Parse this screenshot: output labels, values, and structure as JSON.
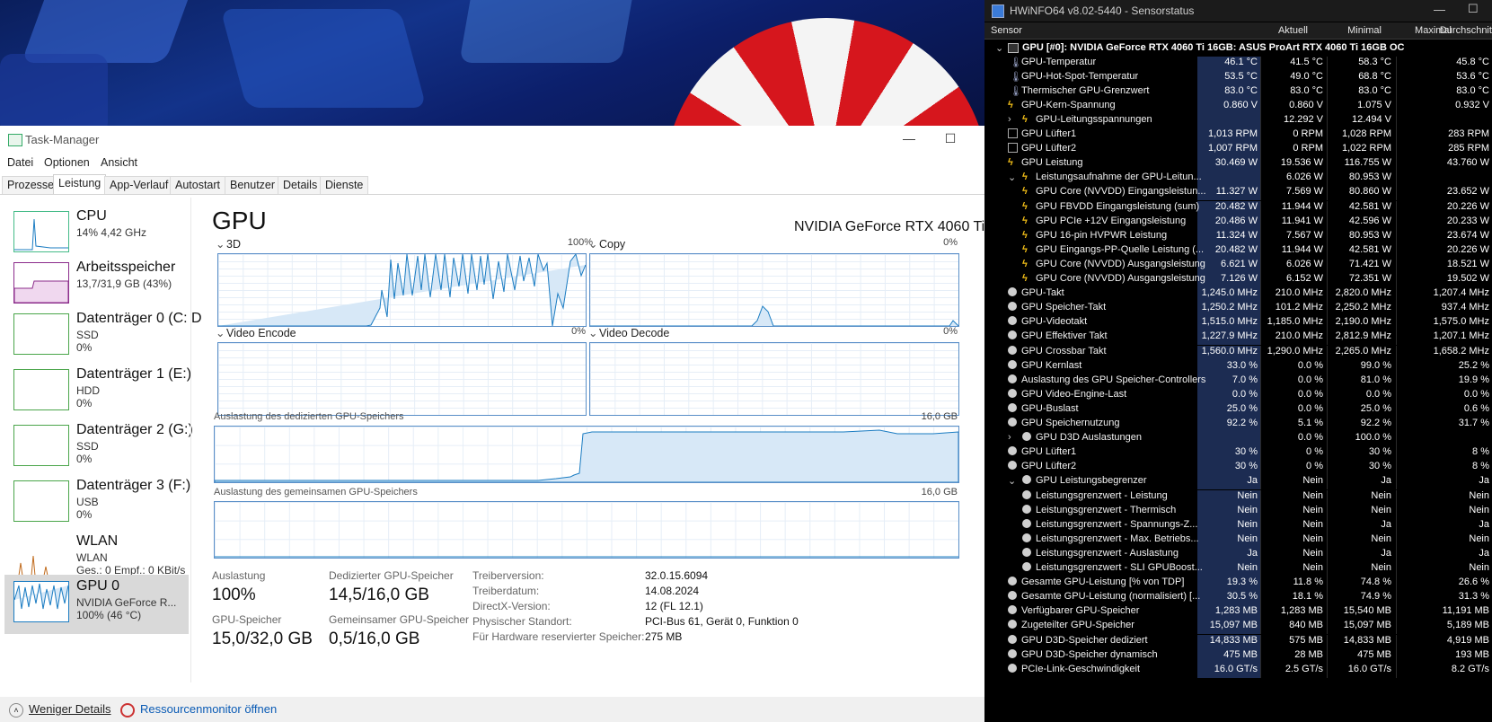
{
  "taskmanager": {
    "title": "Task-Manager",
    "menu": [
      "Datei",
      "Optionen",
      "Ansicht"
    ],
    "tabs": [
      "Prozesse",
      "Leistung",
      "App-Verlauf",
      "Autostart",
      "Benutzer",
      "Details",
      "Dienste"
    ],
    "active_tab": "Leistung",
    "sidebar": [
      {
        "name": "CPU",
        "sub1": "14%  4,42 GHz",
        "sub2": ""
      },
      {
        "name": "Arbeitsspeicher",
        "sub1": "13,7/31,9 GB (43%)",
        "sub2": ""
      },
      {
        "name": "Datenträger 0 (C: D",
        "sub1": "SSD",
        "sub2": "0%"
      },
      {
        "name": "Datenträger 1 (E:)",
        "sub1": "HDD",
        "sub2": "0%"
      },
      {
        "name": "Datenträger 2 (G:)",
        "sub1": "SSD",
        "sub2": "0%"
      },
      {
        "name": "Datenträger 3 (F:)",
        "sub1": "USB",
        "sub2": "0%"
      },
      {
        "name": "WLAN",
        "sub1": "WLAN",
        "sub2": "Ges.: 0  Empf.: 0 KBit/s"
      },
      {
        "name": "GPU 0",
        "sub1": "NVIDIA GeForce R...",
        "sub2": "100%  (46 °C)"
      }
    ],
    "gpu_title": "GPU",
    "gpu_model": "NVIDIA GeForce RTX 4060 Ti",
    "panels": {
      "3d": {
        "label": "3D",
        "pct": "100%"
      },
      "copy": {
        "label": "Copy",
        "pct": "0%"
      },
      "video_encode": {
        "label": "Video Encode",
        "pct": "0%"
      },
      "video_decode": {
        "label": "Video Decode",
        "pct": "0%"
      }
    },
    "dedicated_label": "Auslastung des dedizierten GPU-Speichers",
    "dedicated_max": "16,0 GB",
    "shared_label": "Auslastung des gemeinsamen GPU-Speichers",
    "shared_max": "16,0 GB",
    "stats": {
      "util_label": "Auslastung",
      "util_value": "100%",
      "ded_label": "Dedizierter GPU-Speicher",
      "ded_value": "14,5/16,0 GB",
      "mem_label": "GPU-Speicher",
      "mem_value": "15,0/32,0 GB",
      "shared_label": "Gemeinsamer GPU-Speicher",
      "shared_value": "0,5/16,0 GB"
    },
    "info": [
      {
        "label": "Treiberversion:",
        "value": "32.0.15.6094"
      },
      {
        "label": "Treiberdatum:",
        "value": "14.08.2024"
      },
      {
        "label": "DirectX-Version:",
        "value": "12 (FL 12.1)"
      },
      {
        "label": "Physischer Standort:",
        "value": "PCI-Bus 61, Gerät 0, Funktion 0"
      },
      {
        "label": "Für Hardware reservierter Speicher:",
        "value": "275 MB"
      }
    ],
    "footer": {
      "less_details": "Weniger Details",
      "resmon": "Ressourcenmonitor öffnen"
    }
  },
  "hwinfo": {
    "title": "HWiNFO64 v8.02-5440 - Sensorstatus",
    "columns": [
      "Sensor",
      "Aktuell",
      "Minimal",
      "Maximal",
      "Durchschnitt"
    ],
    "group": "GPU [#0]: NVIDIA GeForce RTX 4060 Ti 16GB: ASUS ProArt RTX 4060 Ti 16GB OC",
    "rows": [
      {
        "icon": "therm",
        "indent": 0,
        "name": "GPU-Temperatur",
        "cur": "46.1 °C",
        "min": "41.5 °C",
        "max": "58.3 °C",
        "avg": "45.8 °C"
      },
      {
        "icon": "therm",
        "indent": 0,
        "name": "GPU-Hot-Spot-Temperatur",
        "cur": "53.5 °C",
        "min": "49.0 °C",
        "max": "68.8 °C",
        "avg": "53.6 °C"
      },
      {
        "icon": "therm",
        "indent": 0,
        "name": "Thermischer GPU-Grenzwert",
        "cur": "83.0 °C",
        "min": "83.0 °C",
        "max": "83.0 °C",
        "avg": "83.0 °C"
      },
      {
        "icon": "bolt",
        "indent": 0,
        "name": "GPU-Kern-Spannung",
        "cur": "0.860 V",
        "min": "0.860 V",
        "max": "1.075 V",
        "avg": "0.932 V"
      },
      {
        "icon": "bolt",
        "indent": 1,
        "expand": ">",
        "name": "GPU-Leitungsspannungen",
        "cur": "",
        "min": "12.292 V",
        "max": "12.494 V",
        "avg": ""
      },
      {
        "icon": "fan",
        "indent": 0,
        "name": "GPU Lüfter1",
        "cur": "1,013 RPM",
        "min": "0 RPM",
        "max": "1,028 RPM",
        "avg": "283 RPM"
      },
      {
        "icon": "fan",
        "indent": 0,
        "name": "GPU Lüfter2",
        "cur": "1,007 RPM",
        "min": "0 RPM",
        "max": "1,022 RPM",
        "avg": "285 RPM"
      },
      {
        "icon": "bolt",
        "indent": 0,
        "name": "GPU Leistung",
        "cur": "30.469 W",
        "min": "19.536 W",
        "max": "116.755 W",
        "avg": "43.760 W"
      },
      {
        "icon": "bolt",
        "indent": 1,
        "expand": "v",
        "name": "Leistungsaufnahme der GPU-Leitun...",
        "cur": "",
        "min": "6.026 W",
        "max": "80.953 W",
        "avg": ""
      },
      {
        "icon": "bolt",
        "indent": 1,
        "name": "GPU Core (NVVDD) Eingangsleistun...",
        "cur": "11.327 W",
        "min": "7.569 W",
        "max": "80.860 W",
        "avg": "23.652 W"
      },
      {
        "icon": "bolt",
        "indent": 1,
        "name": "GPU FBVDD Eingangsleistung (sum)",
        "cur": "20.482 W",
        "min": "11.944 W",
        "max": "42.581 W",
        "avg": "20.226 W"
      },
      {
        "icon": "bolt",
        "indent": 1,
        "name": "GPU PCIe +12V Eingangsleistung",
        "cur": "20.486 W",
        "min": "11.941 W",
        "max": "42.596 W",
        "avg": "20.233 W"
      },
      {
        "icon": "bolt",
        "indent": 1,
        "name": "GPU 16-pin HVPWR Leistung",
        "cur": "11.324 W",
        "min": "7.567 W",
        "max": "80.953 W",
        "avg": "23.674 W"
      },
      {
        "icon": "bolt",
        "indent": 1,
        "name": "GPU Eingangs-PP-Quelle Leistung (...",
        "cur": "20.482 W",
        "min": "11.944 W",
        "max": "42.581 W",
        "avg": "20.226 W"
      },
      {
        "icon": "bolt",
        "indent": 1,
        "name": "GPU Core (NVVDD) Ausgangsleistung",
        "cur": "6.621 W",
        "min": "6.026 W",
        "max": "71.421 W",
        "avg": "18.521 W"
      },
      {
        "icon": "bolt",
        "indent": 1,
        "name": "GPU Core (NVVDD) Ausgangsleistung",
        "cur": "7.126 W",
        "min": "6.152 W",
        "max": "72.351 W",
        "avg": "19.502 W"
      },
      {
        "icon": "dot",
        "indent": 0,
        "name": "GPU-Takt",
        "cur": "1,245.0 MHz",
        "min": "210.0 MHz",
        "max": "2,820.0 MHz",
        "avg": "1,207.4 MHz"
      },
      {
        "icon": "dot",
        "indent": 0,
        "name": "GPU Speicher-Takt",
        "cur": "1,250.2 MHz",
        "min": "101.2 MHz",
        "max": "2,250.2 MHz",
        "avg": "937.4 MHz"
      },
      {
        "icon": "dot",
        "indent": 0,
        "name": "GPU-Videotakt",
        "cur": "1,515.0 MHz",
        "min": "1,185.0 MHz",
        "max": "2,190.0 MHz",
        "avg": "1,575.0 MHz"
      },
      {
        "icon": "dot",
        "indent": 0,
        "name": "GPU Effektiver Takt",
        "cur": "1,227.9 MHz",
        "min": "210.0 MHz",
        "max": "2,812.9 MHz",
        "avg": "1,207.1 MHz"
      },
      {
        "icon": "dot",
        "indent": 0,
        "name": "GPU Crossbar Takt",
        "cur": "1,560.0 MHz",
        "min": "1,290.0 MHz",
        "max": "2,265.0 MHz",
        "avg": "1,658.2 MHz"
      },
      {
        "icon": "dot",
        "indent": 0,
        "name": "GPU Kernlast",
        "cur": "33.0 %",
        "min": "0.0 %",
        "max": "99.0 %",
        "avg": "25.2 %"
      },
      {
        "icon": "dot",
        "indent": 0,
        "name": "Auslastung des GPU Speicher-Controllers",
        "cur": "7.0 %",
        "min": "0.0 %",
        "max": "81.0 %",
        "avg": "19.9 %"
      },
      {
        "icon": "dot",
        "indent": 0,
        "name": "GPU Video-Engine-Last",
        "cur": "0.0 %",
        "min": "0.0 %",
        "max": "0.0 %",
        "avg": "0.0 %"
      },
      {
        "icon": "dot",
        "indent": 0,
        "name": "GPU-Buslast",
        "cur": "25.0 %",
        "min": "0.0 %",
        "max": "25.0 %",
        "avg": "0.6 %"
      },
      {
        "icon": "dot",
        "indent": 0,
        "name": "GPU Speichernutzung",
        "cur": "92.2 %",
        "min": "5.1 %",
        "max": "92.2 %",
        "avg": "31.7 %"
      },
      {
        "icon": "dot",
        "indent": 1,
        "expand": ">",
        "name": "GPU D3D Auslastungen",
        "cur": "",
        "min": "0.0 %",
        "max": "100.0 %",
        "avg": ""
      },
      {
        "icon": "dot",
        "indent": 0,
        "name": "GPU Lüfter1",
        "cur": "30 %",
        "min": "0 %",
        "max": "30 %",
        "avg": "8 %"
      },
      {
        "icon": "dot",
        "indent": 0,
        "name": "GPU Lüfter2",
        "cur": "30 %",
        "min": "0 %",
        "max": "30 %",
        "avg": "8 %"
      },
      {
        "icon": "dot",
        "indent": 1,
        "expand": "v",
        "name": "GPU Leistungsbegrenzer",
        "cur": "Ja",
        "min": "Nein",
        "max": "Ja",
        "avg": "Ja"
      },
      {
        "icon": "dot",
        "indent": 1,
        "name": "Leistungsgrenzwert - Leistung",
        "cur": "Nein",
        "min": "Nein",
        "max": "Nein",
        "avg": "Nein"
      },
      {
        "icon": "dot",
        "indent": 1,
        "name": "Leistungsgrenzwert - Thermisch",
        "cur": "Nein",
        "min": "Nein",
        "max": "Nein",
        "avg": "Nein"
      },
      {
        "icon": "dot",
        "indent": 1,
        "name": "Leistungsgrenzwert - Spannungs-Z...",
        "cur": "Nein",
        "min": "Nein",
        "max": "Ja",
        "avg": "Ja"
      },
      {
        "icon": "dot",
        "indent": 1,
        "name": "Leistungsgrenzwert - Max. Betriebs...",
        "cur": "Nein",
        "min": "Nein",
        "max": "Nein",
        "avg": "Nein"
      },
      {
        "icon": "dot",
        "indent": 1,
        "name": "Leistungsgrenzwert - Auslastung",
        "cur": "Ja",
        "min": "Nein",
        "max": "Ja",
        "avg": "Ja"
      },
      {
        "icon": "dot",
        "indent": 1,
        "name": "Leistungsgrenzwert - SLI GPUBoost...",
        "cur": "Nein",
        "min": "Nein",
        "max": "Nein",
        "avg": "Nein"
      },
      {
        "icon": "dot",
        "indent": 0,
        "name": "Gesamte GPU-Leistung [% von TDP]",
        "cur": "19.3 %",
        "min": "11.8 %",
        "max": "74.8 %",
        "avg": "26.6 %"
      },
      {
        "icon": "dot",
        "indent": 0,
        "name": "Gesamte GPU-Leistung (normalisiert) [...",
        "cur": "30.5 %",
        "min": "18.1 %",
        "max": "74.9 %",
        "avg": "31.3 %"
      },
      {
        "icon": "dot",
        "indent": 0,
        "name": "Verfügbarer GPU-Speicher",
        "cur": "1,283 MB",
        "min": "1,283 MB",
        "max": "15,540 MB",
        "avg": "11,191 MB"
      },
      {
        "icon": "dot",
        "indent": 0,
        "name": "Zugeteilter GPU-Speicher",
        "cur": "15,097 MB",
        "min": "840 MB",
        "max": "15,097 MB",
        "avg": "5,189 MB"
      },
      {
        "icon": "dot",
        "indent": 0,
        "name": "GPU D3D-Speicher dediziert",
        "cur": "14,833 MB",
        "min": "575 MB",
        "max": "14,833 MB",
        "avg": "4,919 MB"
      },
      {
        "icon": "dot",
        "indent": 0,
        "name": "GPU D3D-Speicher dynamisch",
        "cur": "475 MB",
        "min": "28 MB",
        "max": "475 MB",
        "avg": "193 MB"
      },
      {
        "icon": "dot",
        "indent": 0,
        "name": "PCIe-Link-Geschwindigkeit",
        "cur": "16.0 GT/s",
        "min": "2.5 GT/s",
        "max": "16.0 GT/s",
        "avg": "8.2 GT/s"
      }
    ]
  }
}
